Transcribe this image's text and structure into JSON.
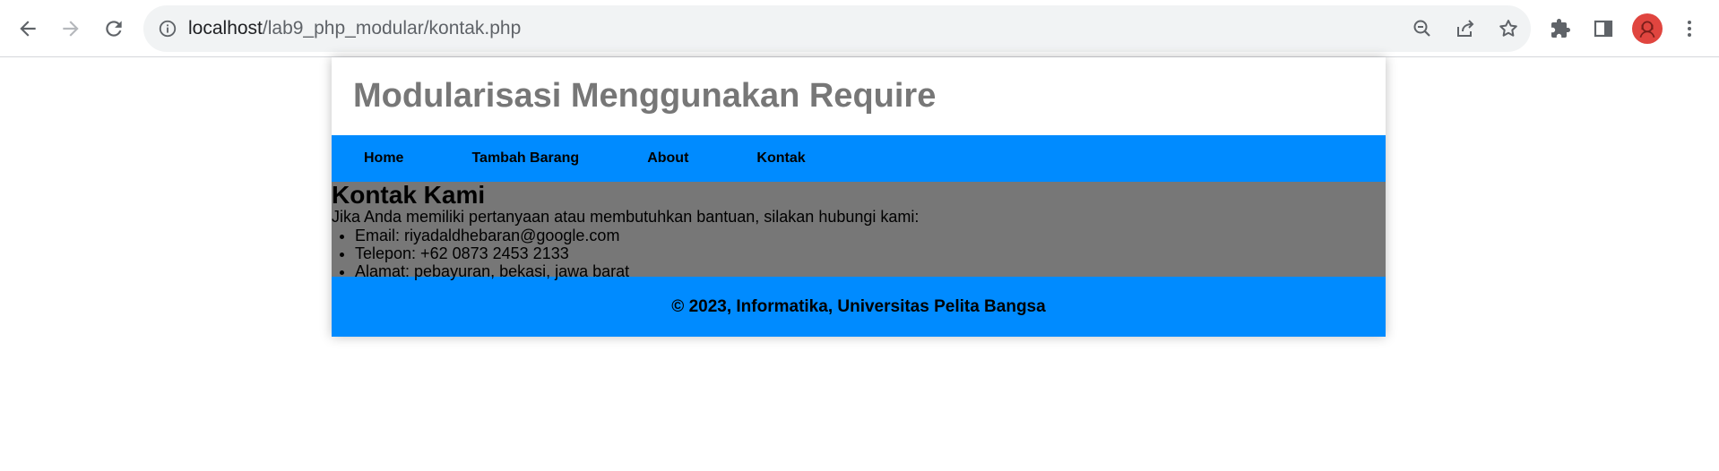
{
  "browser": {
    "url_host": "localhost",
    "url_path": "/lab9_php_modular/kontak.php",
    "icons": {
      "back": "arrow-left-icon",
      "forward": "arrow-right-icon",
      "reload": "reload-icon",
      "site_info": "info-icon",
      "zoom": "zoom-out-icon",
      "share": "share-icon",
      "bookmark": "star-icon",
      "extensions": "puzzle-icon",
      "side_panel": "side-panel-icon",
      "menu": "kebab-menu-icon"
    }
  },
  "page": {
    "site_title": "Modularisasi Menggunakan Require",
    "nav": [
      {
        "label": "Home"
      },
      {
        "label": "Tambah Barang"
      },
      {
        "label": "About"
      },
      {
        "label": "Kontak"
      }
    ],
    "content": {
      "heading": "Kontak Kami",
      "intro": "Jika Anda memiliki pertanyaan atau membutuhkan bantuan, silakan hubungi kami:",
      "items": [
        {
          "text": "Email: riyadaldhebaran@google.com"
        },
        {
          "text": "Telepon: +62 0873 2453 2133"
        },
        {
          "text": "Alamat: pebayuran, bekasi, jawa barat"
        }
      ]
    },
    "footer": "© 2023, Informatika, Universitas Pelita Bangsa"
  },
  "colors": {
    "nav_bg": "#008bff",
    "content_bg": "#777777",
    "title_color": "#777777",
    "avatar_bg": "#e0453f"
  }
}
